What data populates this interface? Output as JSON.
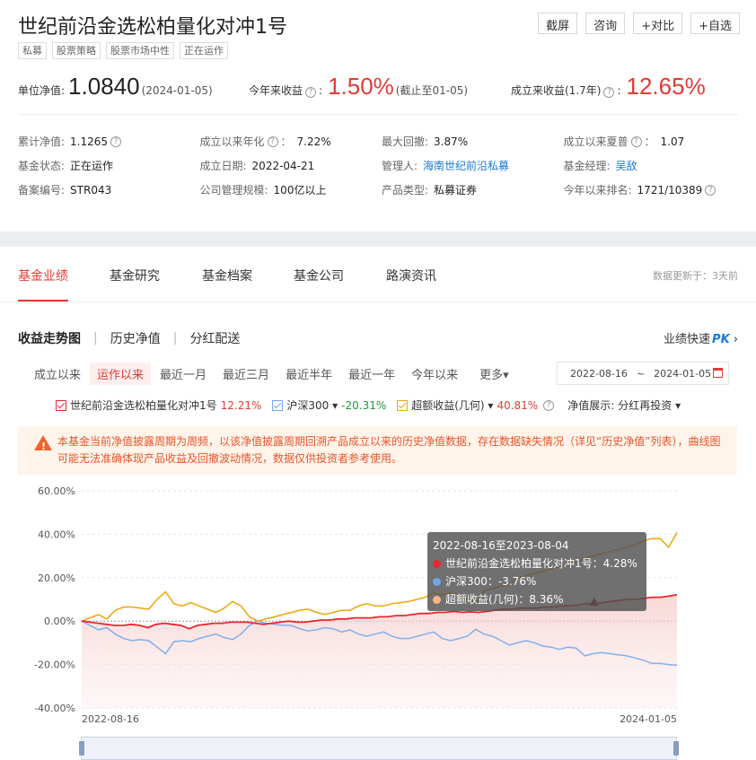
{
  "header": {
    "title": "世纪前沿金选松柏量化对冲1号",
    "tags": [
      "私募",
      "股票策略",
      "股票市场中性",
      "正在运作"
    ],
    "buttons": [
      "截屏",
      "咨询",
      "+对比",
      "+自选"
    ]
  },
  "nav": {
    "label": "单位净值:",
    "value": "1.0840",
    "date": "(2024-01-05)"
  },
  "ytd": {
    "label": "今年来收益",
    "value": "1.50%",
    "note": "(截止至01-05)"
  },
  "since_inception": {
    "label": "成立来收益(1.7年)",
    "value": "12.65%"
  },
  "stats": [
    [
      {
        "label": "累计净值:",
        "value": "1.1265",
        "help": true
      },
      {
        "label": "成立以来年化",
        "value": "7.22%",
        "help": true,
        "colon": "："
      },
      {
        "label": "最大回撤:",
        "value": "3.87%"
      },
      {
        "label": "成立以来夏普",
        "value": "1.07",
        "help": true,
        "colon": "："
      }
    ],
    [
      {
        "label": "基金状态:",
        "value": "正在运作"
      },
      {
        "label": "成立日期:",
        "value": "2022-04-21"
      },
      {
        "label": "管理人:",
        "value": "海南世纪前沿私募",
        "link": true
      },
      {
        "label": "基金经理:",
        "value": "吴敌",
        "link": true
      }
    ],
    [
      {
        "label": "备案编号:",
        "value": "STR043"
      },
      {
        "label": "公司管理规模:",
        "value": "100亿以上"
      },
      {
        "label": "产品类型:",
        "value": "私募证券"
      },
      {
        "label": "今年以来排名:",
        "value": "1721/10389",
        "help_after": true
      }
    ]
  ],
  "tabs": [
    "基金业绩",
    "基金研究",
    "基金档案",
    "基金公司",
    "路演资讯"
  ],
  "update_note": "数据更新于：3天前",
  "subtabs": [
    "收益走势图",
    "历史净值",
    "分红配送"
  ],
  "pk": {
    "label": "业绩快速",
    "brand": "PK",
    "arrow": "›"
  },
  "ranges": [
    "成立以来",
    "运作以来",
    "最近一月",
    "最近三月",
    "最近半年",
    "最近一年",
    "今年以来",
    "更多▾"
  ],
  "active_range": 1,
  "date_range": {
    "start": "2022-08-16",
    "sep": "~",
    "end": "2024-01-05"
  },
  "legend": [
    {
      "name": "世纪前沿金选松柏量化对冲1号",
      "value": "12.21%",
      "color": "#e8272f",
      "value_color": "#e13b35"
    },
    {
      "name": "沪深300 ▾",
      "value": "-20.31%",
      "color": "#6fa8e8",
      "value_color": "#1a9a3a"
    },
    {
      "name": "超额收益(几何) ▾",
      "value": "40.81%",
      "color": "#f0a30a",
      "value_color": "#e13b35",
      "help": true
    }
  ],
  "nav_display": {
    "label": "净值展示:",
    "value": "分红再投资 ▾"
  },
  "warning": "本基金当前净值披露周期为周频，以该净值披露周期回溯产品成立以来的历史净值数据，存在数据缺失情况（详见“历史净值”列表），曲线图可能无法准确体现产品收益及回撤波动情况，数据仅供投资者参考使用。",
  "tooltip": {
    "title": "2022-08-16至2023-08-04",
    "rows": [
      {
        "name": "世纪前沿金选松柏量化对冲1号：",
        "value": "4.28%",
        "color": "#e8272f"
      },
      {
        "name": "沪深300：",
        "value": "-3.76%",
        "color": "#6fa8e8"
      },
      {
        "name": "超额收益(几何)：",
        "value": "8.36%",
        "color": "#f7b683"
      }
    ]
  },
  "chart_data": {
    "type": "line",
    "x_start": "2022-08-16",
    "x_end": "2024-01-05",
    "ylim": [
      -40,
      60
    ],
    "yticks": [
      "60.00%",
      "40.00%",
      "20.00%",
      "0.00%",
      "-20.00%",
      "-40.00%"
    ],
    "ytick_values": [
      60,
      40,
      20,
      0,
      -20,
      -40
    ],
    "series": [
      {
        "name": "世纪前沿金选松柏量化对冲1号",
        "color": "#e8272f",
        "values": [
          0,
          -0.5,
          -1,
          -1.5,
          -2,
          -2,
          -1.5,
          -2,
          -3,
          -1.5,
          -1,
          -1.5,
          -2,
          -3.5,
          -2,
          -1.5,
          -1,
          -1,
          -0.5,
          -0.5,
          -0.5,
          -1,
          -1.5,
          -1,
          -0.5,
          0,
          -0.5,
          -0.5,
          0,
          0.5,
          0.5,
          1,
          1,
          1.5,
          1.5,
          1.5,
          2,
          2,
          2.5,
          2.5,
          3,
          3.5,
          3.5,
          4,
          4,
          4.5,
          4,
          4.28,
          4,
          4.5,
          5,
          5.5,
          5.5,
          6,
          6,
          6,
          6.5,
          6.5,
          7,
          7,
          7.5,
          8,
          8,
          8.5,
          9,
          9.5,
          10,
          10,
          10.5,
          11,
          11,
          11.5,
          12.21
        ]
      },
      {
        "name": "沪深300",
        "color": "#7fb0ea",
        "values": [
          0,
          -2,
          -4,
          -3,
          -6,
          -8,
          -9,
          -8.5,
          -9,
          -12,
          -15,
          -9.5,
          -9,
          -9.5,
          -8,
          -7,
          -6,
          -7.5,
          -8.5,
          -6,
          -2,
          0,
          -1,
          -1.5,
          -2,
          -2,
          -3.5,
          -4.5,
          -4,
          -3,
          -3.5,
          -5,
          -4,
          -6,
          -7,
          -6,
          -5,
          -7,
          -8,
          -8,
          -7,
          -6,
          -5,
          -8,
          -9,
          -8,
          -7,
          -3.76,
          -6,
          -7,
          -9,
          -11,
          -10,
          -9,
          -10,
          -11.5,
          -12,
          -13,
          -12,
          -12.5,
          -16,
          -15,
          -14.5,
          -15,
          -15.5,
          -16,
          -17,
          -18,
          -19.5,
          -19.5,
          -20,
          -20.31
        ]
      },
      {
        "name": "超额收益(几何)",
        "color": "#f0a30a",
        "values": [
          0,
          1.5,
          3,
          1,
          5,
          6.5,
          6.5,
          6,
          5.5,
          10,
          13.5,
          8,
          7,
          8.5,
          7,
          5.5,
          4,
          6,
          9,
          7,
          2,
          0,
          1,
          2,
          3,
          4,
          5,
          5.5,
          4,
          3,
          4,
          5,
          5,
          7,
          8,
          7,
          7,
          8,
          8.5,
          9,
          10,
          11,
          13,
          12,
          13,
          12,
          10,
          8.36,
          14,
          15,
          16,
          17,
          20,
          21,
          22,
          23,
          24,
          25,
          26,
          27,
          29,
          30,
          31,
          32,
          33,
          34,
          35,
          37,
          38,
          38,
          34,
          40.81
        ]
      }
    ],
    "marker": {
      "x_index": 62,
      "y": 9
    }
  }
}
